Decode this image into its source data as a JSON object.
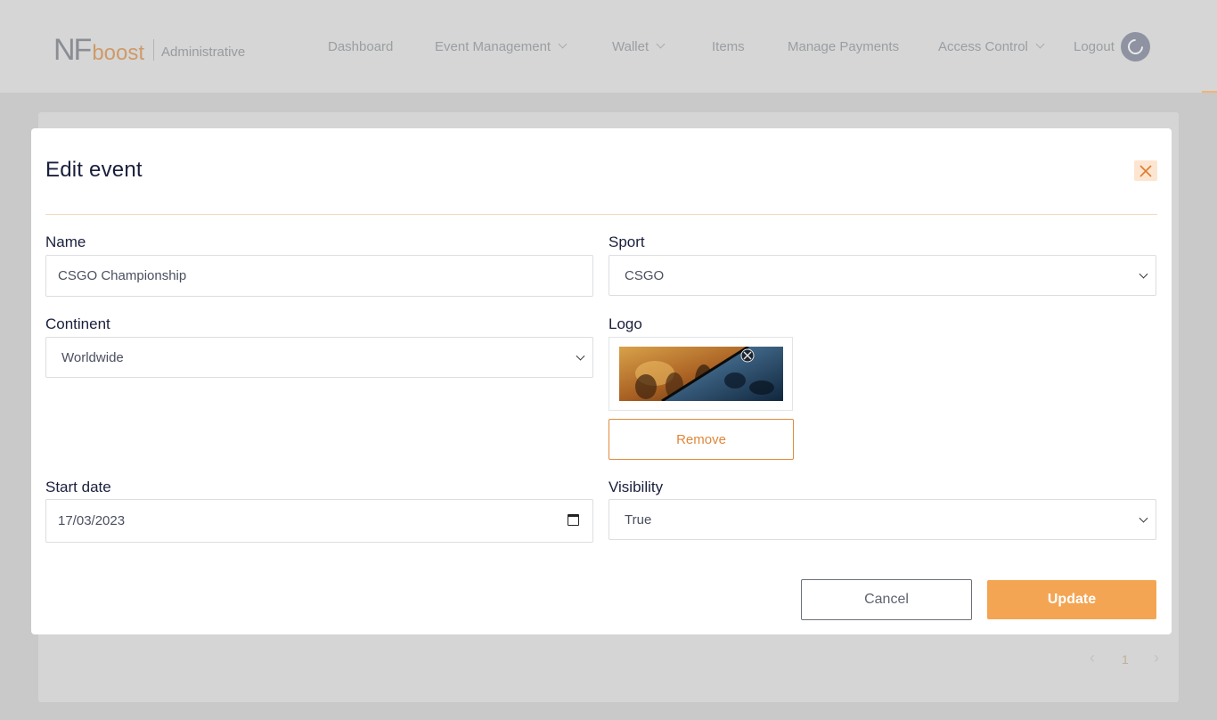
{
  "app": {
    "logo_nf": "NF",
    "logo_boost": "boost",
    "logo_sub": "Administrative"
  },
  "nav": {
    "dashboard": "Dashboard",
    "event_management": "Event Management",
    "wallet": "Wallet",
    "items": "Items",
    "manage_payments": "Manage Payments",
    "access_control": "Access Control",
    "logout": "Logout"
  },
  "pagination": {
    "prev": "‹",
    "page": "1",
    "next": "›"
  },
  "modal": {
    "title": "Edit event",
    "name_label": "Name",
    "name_value": "CSGO Championship",
    "sport_label": "Sport",
    "sport_value": "CSGO",
    "continent_label": "Continent",
    "continent_value": "Worldwide",
    "logo_label": "Logo",
    "remove_label": "Remove",
    "start_date_label": "Start date",
    "start_date_value": "17/03/2023",
    "visibility_label": "Visibility",
    "visibility_value": "True",
    "cancel_label": "Cancel",
    "update_label": "Update"
  },
  "colors": {
    "accent": "#f4a553",
    "overlay": "#c8c9c8"
  }
}
